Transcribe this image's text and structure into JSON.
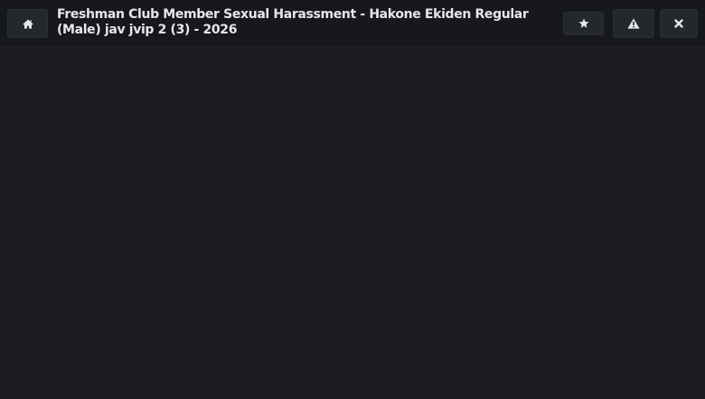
{
  "header": {
    "title": "Freshman Club Member Sexual Harassment - Hakone Ekiden Regular (Male) jav jvip 2 (3) - 2026",
    "buttons": {
      "home_icon": "home-icon",
      "favorite_icon": "star-icon",
      "report_icon": "warning-icon",
      "close_icon": "close-icon"
    }
  },
  "colors": {
    "background": "#1a1c20",
    "header_background": "#16181b",
    "button_background": "#24272c",
    "icon": "#e6e7e9"
  }
}
